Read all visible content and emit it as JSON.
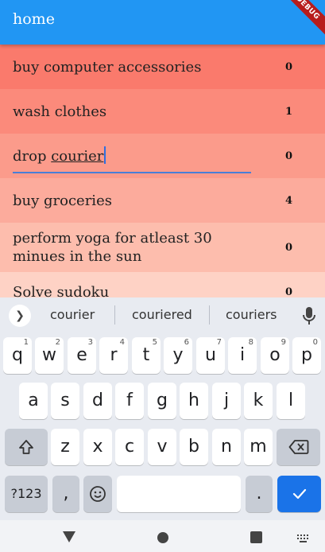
{
  "appbar": {
    "title": "home",
    "debug_label": "DEBUG",
    "color": "#2196f3"
  },
  "todos": [
    {
      "title": "buy computer accessories",
      "count": "0",
      "color": "#fa7a6c"
    },
    {
      "title": "wash clothes",
      "count": "1",
      "color": "#fb8a7b"
    },
    {
      "title_prefix": "drop ",
      "title_word": "courier",
      "count": "0",
      "color": "#fb9b8b",
      "editing": true
    },
    {
      "title": "buy groceries",
      "count": "4",
      "color": "#fcab9c"
    },
    {
      "title": "perform yoga for atleast 30 minues in the sun",
      "count": "0",
      "color": "#fdbdad"
    },
    {
      "title": "Solve sudoku",
      "count": "0",
      "color": "#fed2c5"
    }
  ],
  "keyboard": {
    "suggestions": [
      "courier",
      "couriered",
      "couriers"
    ],
    "row1": [
      {
        "key": "q",
        "hint": "1"
      },
      {
        "key": "w",
        "hint": "2"
      },
      {
        "key": "e",
        "hint": "3"
      },
      {
        "key": "r",
        "hint": "4"
      },
      {
        "key": "t",
        "hint": "5"
      },
      {
        "key": "y",
        "hint": "6"
      },
      {
        "key": "u",
        "hint": "7"
      },
      {
        "key": "i",
        "hint": "8"
      },
      {
        "key": "o",
        "hint": "9"
      },
      {
        "key": "p",
        "hint": "0"
      }
    ],
    "row2": [
      "a",
      "s",
      "d",
      "f",
      "g",
      "h",
      "j",
      "k",
      "l"
    ],
    "row3": [
      "z",
      "x",
      "c",
      "v",
      "b",
      "n",
      "m"
    ],
    "symbols_label": "?123",
    "comma_label": ",",
    "period_label": ".",
    "accent_color": "#1a73e8"
  },
  "icons": {
    "suggest_expand": "chevron-right-icon",
    "mic": "mic-icon",
    "shift": "shift-icon",
    "backspace": "backspace-icon",
    "emoji": "emoji-icon",
    "enter": "checkmark-icon",
    "nav_back": "triangle-back-icon",
    "nav_home": "circle-home-icon",
    "nav_recents": "square-recents-icon",
    "nav_keyboard": "keyboard-switch-icon"
  }
}
